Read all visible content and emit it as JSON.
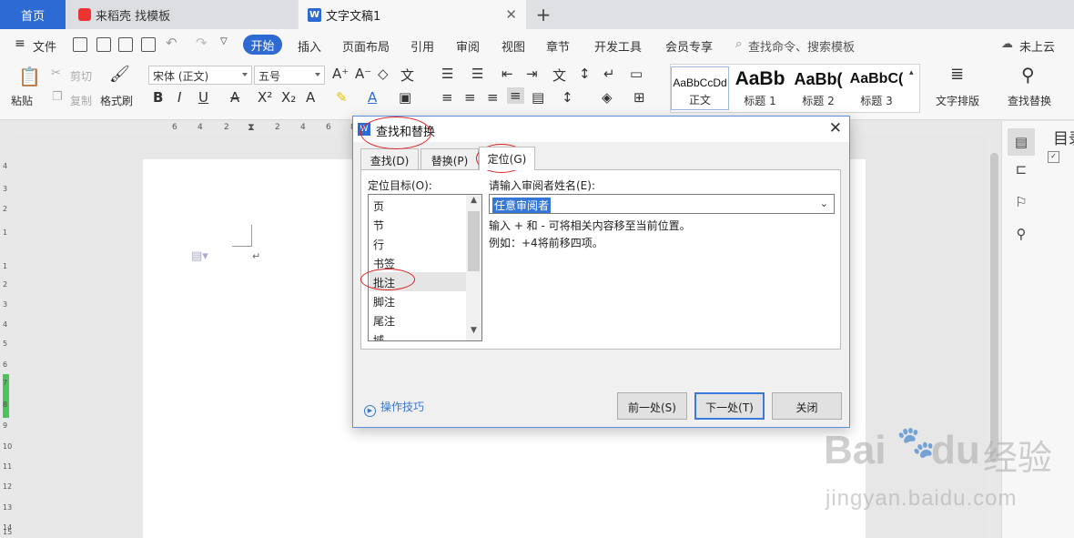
{
  "tabs": {
    "home": "首页",
    "store": "来稻壳 找模板",
    "doc": "文字文稿1",
    "close_glyph": "✕",
    "add_glyph": "+"
  },
  "menu": {
    "file": "文件",
    "items": [
      "开始",
      "插入",
      "页面布局",
      "引用",
      "审阅",
      "视图",
      "章节",
      "开发工具",
      "会员专享"
    ],
    "search": "查找命令、搜索模板",
    "cloud": "未上云"
  },
  "ribbon": {
    "paste": "粘贴",
    "cut": "剪切",
    "copy": "复制",
    "format_painter": "格式刷",
    "font": "宋体 (正文)",
    "size": "五号",
    "styles": [
      {
        "preview": "AaBbCcDd",
        "name": "正文"
      },
      {
        "preview": "AaBb",
        "name": "标题 1"
      },
      {
        "preview": "AaBb(",
        "name": "标题 2"
      },
      {
        "preview": "AaBbC(",
        "name": "标题 3"
      }
    ],
    "text_layout": "文字排版",
    "find_replace": "查找替换"
  },
  "dialog": {
    "title": "查找和替换",
    "tabs": [
      "查找(D)",
      "替换(P)",
      "定位(G)"
    ],
    "target_label": "定位目标(O):",
    "targets": [
      "页",
      "节",
      "行",
      "书签",
      "批注",
      "脚注",
      "尾注",
      "域"
    ],
    "selected_target": "批注",
    "reviewer_label": "请输入审阅者姓名(E):",
    "reviewer_value": "任意审阅者",
    "hint1": "输入 + 和 - 可将相关内容移至当前位置。",
    "hint2": "例如：+4将前移四项。",
    "tips": "操作技巧",
    "prev": "前一处(S)",
    "next": "下一处(T)",
    "close": "关闭"
  },
  "watermark": {
    "brand": "Bai",
    "brand2": "du",
    "cn": "经验",
    "url": "jingyan.baidu.com"
  },
  "right_panel": {
    "label": "目录"
  },
  "ruler_top": [
    "6",
    "4",
    "2",
    "2",
    "4",
    "6",
    "8"
  ],
  "ruler_left": [
    "4",
    "3",
    "2",
    "1",
    "1",
    "2",
    "3",
    "4",
    "5",
    "6",
    "7",
    "8",
    "9",
    "10",
    "11",
    "12",
    "13",
    "14",
    "15"
  ],
  "colors": {
    "accent": "#2d6ad4",
    "annotation": "#d22222"
  }
}
